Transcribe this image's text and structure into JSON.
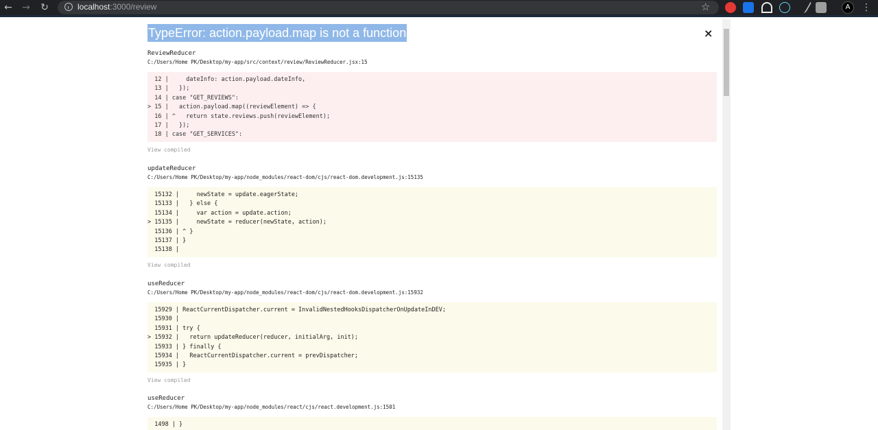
{
  "browser": {
    "url_host": "localhost",
    "url_path": ":3000/review",
    "nav": {
      "back": "←",
      "forward": "→",
      "reload": "↻"
    },
    "star": "☆",
    "menu": "⋮",
    "avatar": "A",
    "extension_colors": [
      "#e53935",
      "#1a73e8",
      "#ffffff",
      "#61dafb",
      "#9e9e9e",
      "#bdbdbd"
    ]
  },
  "overlay": {
    "title": "TypeError: action.payload.map is not a function",
    "close": "×",
    "view_compiled": "View compiled",
    "frames": [
      {
        "name": "ReviewReducer",
        "file": "C:/Users/Home PK/Desktop/my-app/src/context/review/ReviewReducer.jsx:15",
        "lines": [
          "  12 |     dateInfo: action.payload.dateInfo,",
          "  13 |   });",
          "  14 | case \"GET_REVIEWS\":",
          "> 15 |   action.payload.map((reviewElement) => {",
          "  16 | ^   return state.reviews.push(reviewElement);",
          "  17 |   });",
          "  18 | case \"GET_SERVICES\":"
        ]
      },
      {
        "name": "updateReducer",
        "file": "C:/Users/Home PK/Desktop/my-app/node_modules/react-dom/cjs/react-dom.development.js:15135",
        "lines": [
          "  15132 |     newState = update.eagerState;",
          "  15133 |   } else {",
          "  15134 |     var action = update.action;",
          "> 15135 |     newState = reducer(newState, action);",
          "  15136 | ^ }",
          "  15137 | }",
          "  15138 |"
        ]
      },
      {
        "name": "useReducer",
        "file": "C:/Users/Home PK/Desktop/my-app/node_modules/react-dom/cjs/react-dom.development.js:15932",
        "lines": [
          "  15929 | ReactCurrentDispatcher.current = InvalidNestedHooksDispatcherOnUpdateInDEV;",
          "  15930 |",
          "  15931 | try {",
          "> 15932 |   return updateReducer(reducer, initialArg, init);",
          "  15933 | } finally {",
          "  15934 |   ReactCurrentDispatcher.current = prevDispatcher;",
          "  15935 | }"
        ]
      },
      {
        "name": "useReducer",
        "file": "C:/Users/Home PK/Desktop/my-app/node_modules/react/cjs/react.development.js:1501",
        "lines": [
          "  1498 | }"
        ]
      }
    ]
  }
}
